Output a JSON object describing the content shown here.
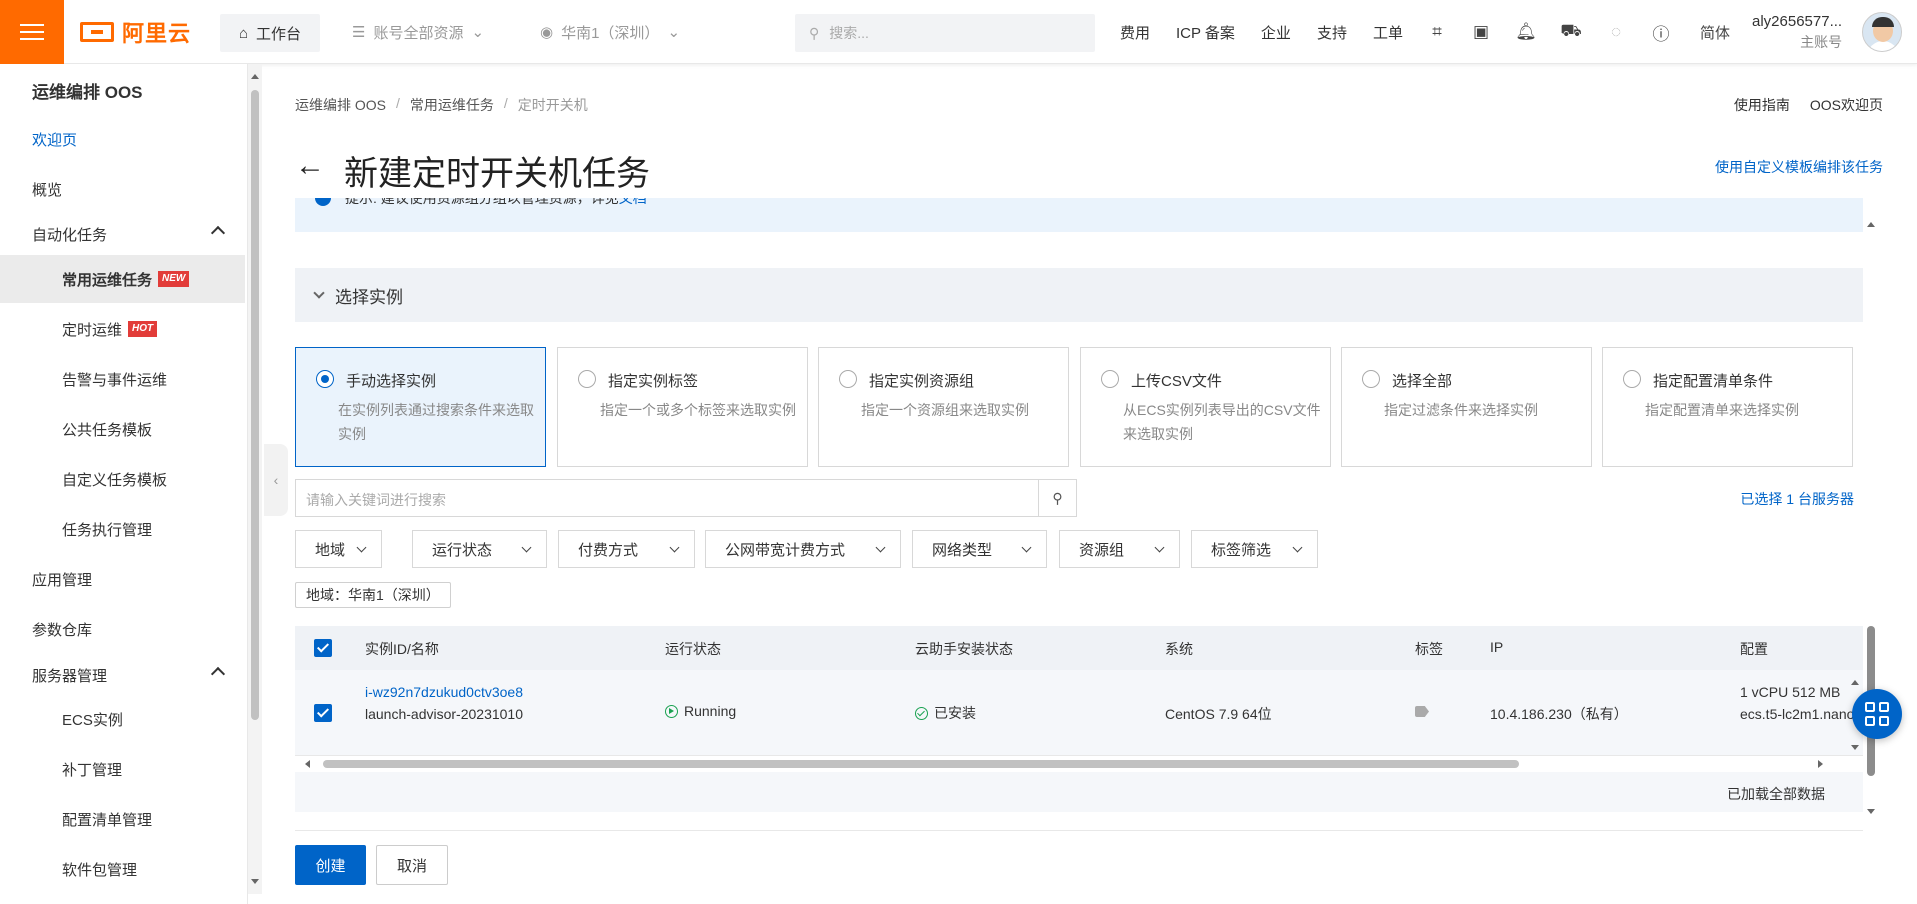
{
  "topbar": {
    "logo": "阿里云",
    "workbench": "工作台",
    "resources": "账号全部资源",
    "region": "华南1（深圳）",
    "search_placeholder": "搜索...",
    "links": [
      "费用",
      "ICP 备案",
      "企业",
      "支持",
      "工单"
    ],
    "lang": "简体",
    "user_name": "aly2656577...",
    "user_role": "主账号",
    "icons": [
      "ai-assistant-icon",
      "terminal-icon",
      "bell-icon",
      "cart-icon",
      "bulb-icon",
      "help-icon"
    ]
  },
  "sidebar": {
    "title": "运维编排 OOS",
    "items": [
      {
        "label": "欢迎页",
        "level": 1,
        "link": true
      },
      {
        "label": "概览",
        "level": 1
      },
      {
        "label": "自动化任务",
        "level": 1,
        "expandable": true
      },
      {
        "label": "常用运维任务",
        "level": 2,
        "active": true,
        "badge": "NEW"
      },
      {
        "label": "定时运维",
        "level": 2,
        "badge": "HOT"
      },
      {
        "label": "告警与事件运维",
        "level": 2
      },
      {
        "label": "公共任务模板",
        "level": 2
      },
      {
        "label": "自定义任务模板",
        "level": 2
      },
      {
        "label": "任务执行管理",
        "level": 2
      },
      {
        "label": "应用管理",
        "level": 1
      },
      {
        "label": "参数仓库",
        "level": 1
      },
      {
        "label": "服务器管理",
        "level": 1,
        "expandable": true
      },
      {
        "label": "ECS实例",
        "level": 2
      },
      {
        "label": "补丁管理",
        "level": 2
      },
      {
        "label": "配置清单管理",
        "level": 2
      },
      {
        "label": "软件包管理",
        "level": 2
      }
    ]
  },
  "breadcrumb": [
    "运维编排 OOS",
    "常用运维任务",
    "定时开关机"
  ],
  "header_links": [
    "使用指南",
    "OOS欢迎页"
  ],
  "page_title": "新建定时开关机任务",
  "template_link": "使用自定义模板编排该任务",
  "tip": {
    "text": "提示: 建议使用资源组分组以管理资源，详见",
    "link": "文档"
  },
  "section_title": "选择实例",
  "selection_modes": [
    {
      "title": "手动选择实例",
      "desc": "在实例列表通过搜索条件来选取实例",
      "selected": true
    },
    {
      "title": "指定实例标签",
      "desc": "指定一个或多个标签来选取实例"
    },
    {
      "title": "指定实例资源组",
      "desc": "指定一个资源组来选取实例"
    },
    {
      "title": "上传CSV文件",
      "desc": "从ECS实例列表导出的CSV文件来选取实例"
    },
    {
      "title": "选择全部",
      "desc": "指定过滤条件来选择实例"
    },
    {
      "title": "指定配置清单条件",
      "desc": "指定配置清单来选择实例"
    }
  ],
  "instance_search_placeholder": "请输入关键词进行搜索",
  "selected_count": "已选择 1 台服务器",
  "filters": [
    "地域",
    "运行状态",
    "付费方式",
    "公网带宽计费方式",
    "网络类型",
    "资源组",
    "标签筛选"
  ],
  "region_chip": "地域：华南1（深圳）",
  "table": {
    "columns": [
      "实例ID/名称",
      "运行状态",
      "云助手安装状态",
      "系统",
      "标签",
      "IP",
      "配置"
    ],
    "rows": [
      {
        "id": "i-wz92n7dzukud0ctv3oe8",
        "name": "launch-advisor-20231010",
        "status": "Running",
        "agent": "已安装",
        "os": "CentOS 7.9 64位",
        "ip": "10.4.186.230（私有）",
        "spec_line1": "1 vCPU 512 MB",
        "spec_line2": "ecs.t5-lc2m1.nano"
      }
    ],
    "footer": "已加载全部数据"
  },
  "buttons": {
    "create": "创建",
    "cancel": "取消"
  },
  "colors": {
    "brand": "#ff6a00",
    "primary": "#0064c8",
    "success": "#1aa251"
  }
}
